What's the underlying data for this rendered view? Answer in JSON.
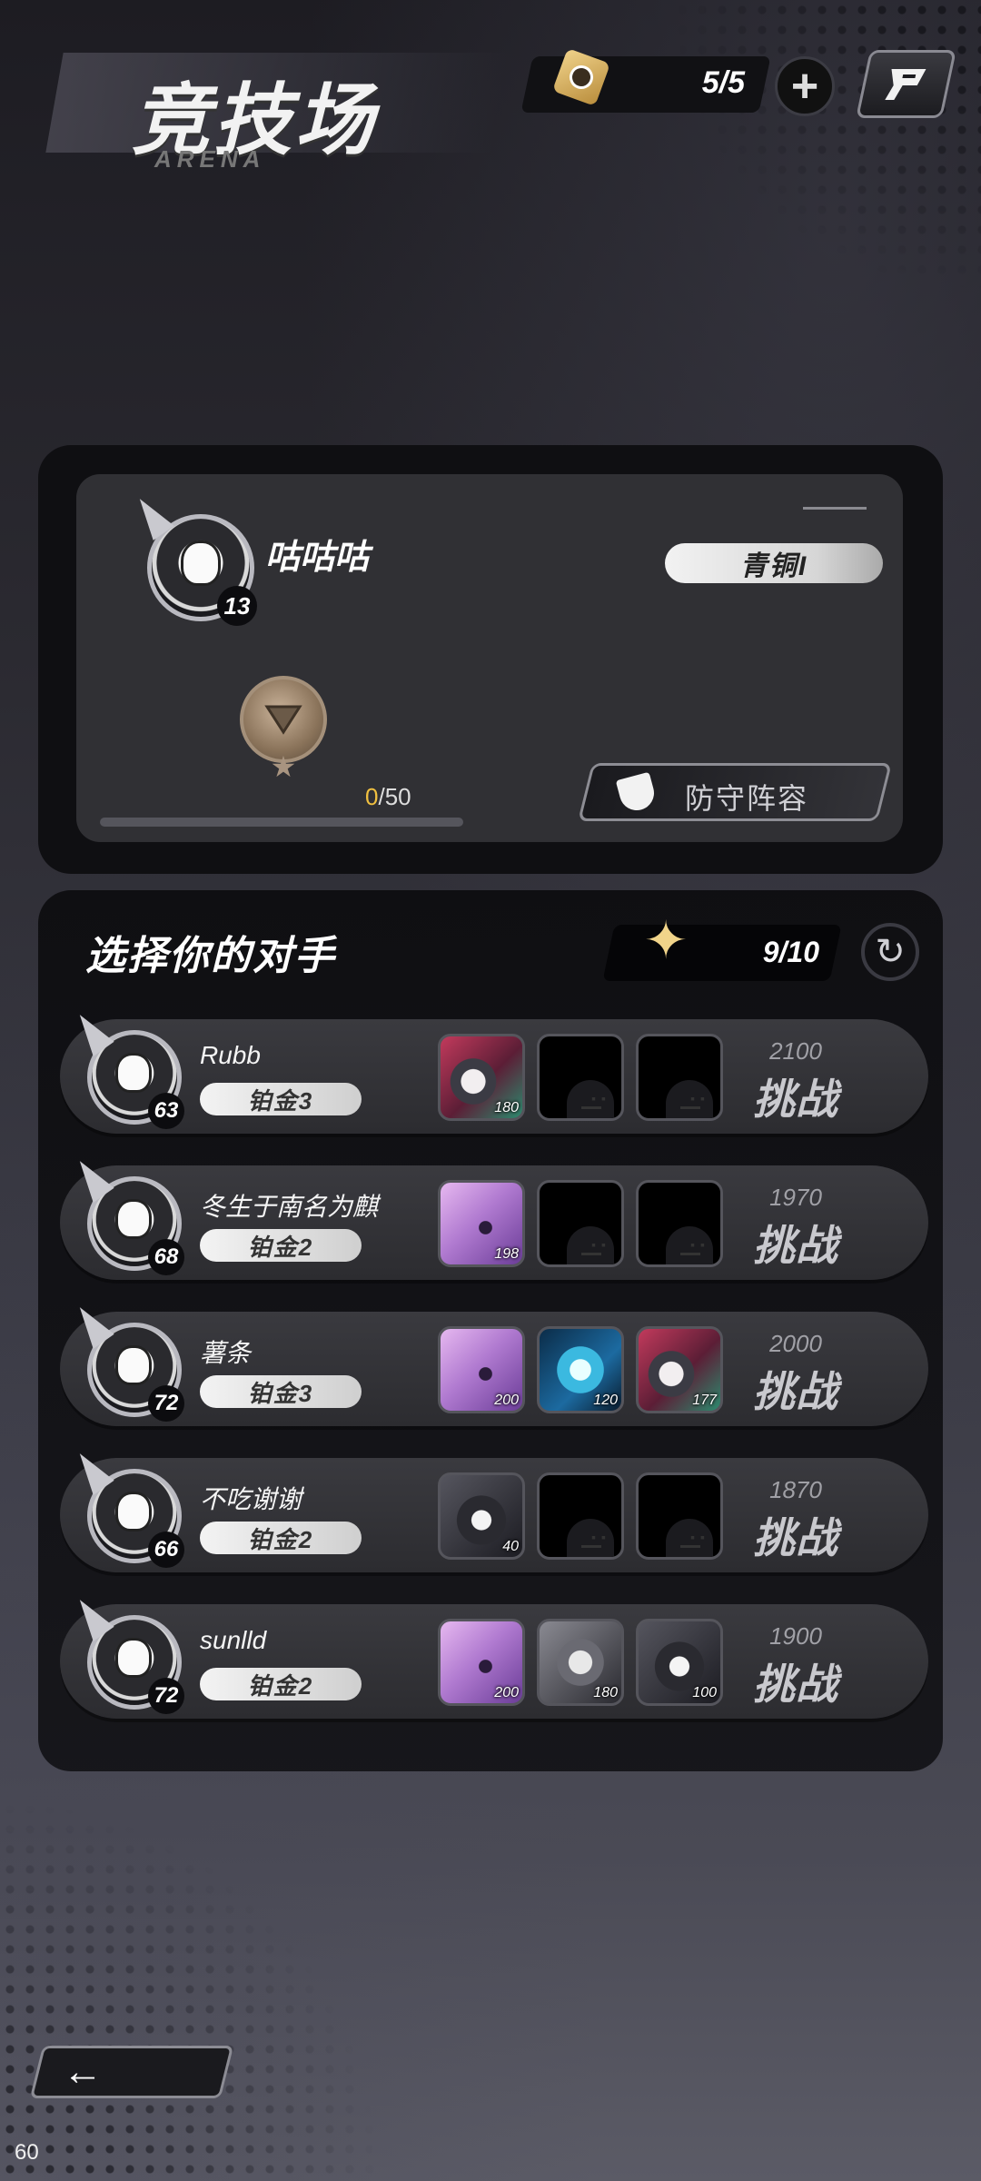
{
  "header": {
    "title": "竞技场",
    "subtitle": "ARENA",
    "tickets": "5/5",
    "add_icon": "plus-icon",
    "share_icon": "share-icon"
  },
  "player": {
    "name": "咕咕咕",
    "level": "13",
    "rank": "青铜I",
    "progress_current": "0",
    "progress_total": "/50",
    "progress_fraction": 0.0,
    "defense_label": "防守阵容"
  },
  "opponents_section": {
    "title": "选择你的对手",
    "refresh_count": "9/10"
  },
  "opponents": [
    {
      "name": "Rubb",
      "level": "63",
      "rank": "铂金3",
      "score": "2100",
      "challenge": "挑战",
      "team": [
        {
          "style": "red",
          "power": "180"
        },
        {
          "style": "empty",
          "power": ""
        },
        {
          "style": "empty",
          "power": ""
        }
      ]
    },
    {
      "name": "冬生于南名为麒",
      "level": "68",
      "rank": "铂金2",
      "score": "1970",
      "challenge": "挑战",
      "team": [
        {
          "style": "purple",
          "power": "198"
        },
        {
          "style": "empty",
          "power": ""
        },
        {
          "style": "empty",
          "power": ""
        }
      ]
    },
    {
      "name": "薯条",
      "level": "72",
      "rank": "铂金3",
      "score": "2000",
      "challenge": "挑战",
      "team": [
        {
          "style": "purple",
          "power": "200"
        },
        {
          "style": "cyan",
          "power": "120"
        },
        {
          "style": "red",
          "power": "177"
        }
      ]
    },
    {
      "name": "不吃谢谢",
      "level": "66",
      "rank": "铂金2",
      "score": "1870",
      "challenge": "挑战",
      "team": [
        {
          "style": "dark",
          "power": "40"
        },
        {
          "style": "empty",
          "power": ""
        },
        {
          "style": "empty",
          "power": ""
        }
      ]
    },
    {
      "name": "sunlld",
      "level": "72",
      "rank": "铂金2",
      "score": "1900",
      "challenge": "挑战",
      "team": [
        {
          "style": "purple",
          "power": "200"
        },
        {
          "style": "gray",
          "power": "180"
        },
        {
          "style": "dark",
          "power": "100"
        }
      ]
    }
  ],
  "footer": {
    "back_icon": "back-arrow-icon",
    "back_glyph": "←",
    "fps": "60"
  },
  "colors": {
    "accent_gold": "#f0c040",
    "panel": "#0f0f12",
    "row": "#333338"
  }
}
